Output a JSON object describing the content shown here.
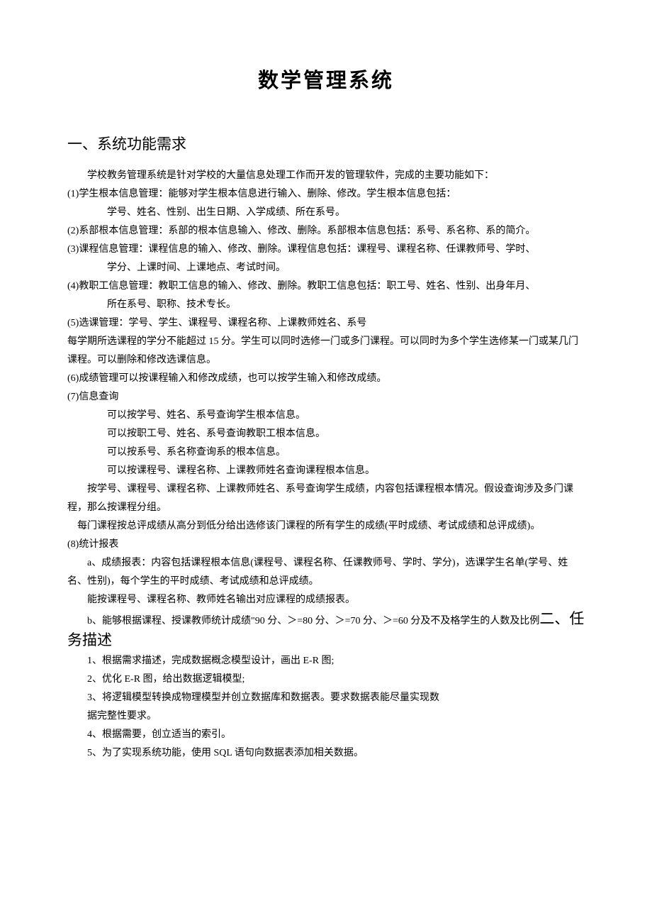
{
  "title": "数学管理系统",
  "section1": {
    "heading": "一、系统功能需求",
    "intro": "学校教务管理系统是针对学校的大量信息处理工作而开发的管理软件，完成的主要功能如下：",
    "items": [
      {
        "line1": "(1)学生根本信息管理：能够对学生根本信息进行输入、删除、修改。学生根本信息包括：",
        "line2": "学号、姓名、性别、出生日期、入学成绩、所在系号。"
      },
      {
        "line1": "(2)系部根本信息管理：系部的根本信息输入、修改、删除。系部根本信息包括：系号、系名称、系的简介。"
      },
      {
        "line1": "(3)课程信息管理：课程信息的输入、修改、删除。课程信息包括：课程号、课程名称、任课教师号、学时、",
        "line2": "学分、上课时间、上课地点、考试时间。"
      },
      {
        "line1": "(4)教职工信息管理：教职工信息的输入、修改、删除。教职工信息包括：职工号、姓名、性别、出身年月、",
        "line2": "所在系号、职称、技术专长。"
      },
      {
        "line1": "(5)选课管理：学号、学生、课程号、课程名称、上课教师姓名、系号",
        "extra1": "每学期所选课程的学分不能超过 15 分。学生可以同时选修一门或多门课程。可以同时为多个学生选修某一门或某几门课程。可以删除和修改选课信息。"
      },
      {
        "line1": "(6)成绩管理可以按课程输入和修改成绩，也可以按学生输入和修改成绩。"
      },
      {
        "line1": "(7)信息查询",
        "sub": [
          "可以按学号、姓名、系号查询学生根本信息。",
          "可以按职工号、姓名、系号查询教职工根本信息。",
          "可以按系号、系名称查询系的根本信息。",
          "可以按课程号、课程名称、上课教师姓名查询课程根本信息。"
        ],
        "extra1": "按学号、课程号、课程名称、上课教师姓名、系号查询学生成绩，内容包括课程根本情况。假设查询涉及多门课程，那么按课程分组。",
        "extra2": "每门课程按总评成绩从高分到低分给出选修该门课程的所有学生的成绩(平时成绩、考试成绩和总评成绩)。"
      },
      {
        "line1": "(8)统计报表",
        "suba": "a、成绩报表：内容包括课程根本信息(课程号、课程名称、任课教师号、学时、学分)，选课学生名单(学号、姓名、性别)，每个学生的平时成绩、考试成绩和总评成绩。",
        "suba2": "能按课程号、课程名称、教师姓名输出对应课程的成绩报表。",
        "subb_prefix": "b、能够根据课程、授课教师统计成绩\"90 分、＞=80 分、＞=70 分、＞=60 分及不及格学生的人数及比例"
      }
    ]
  },
  "section2": {
    "heading": "二、任务描述",
    "items": [
      "1、根据需求描述，完成数据概念模型设计，画出 E-R 图;",
      "2、优化 E-R 图，给出数据逻辑模型;",
      "3、将逻辑模型转换成物理模型并创立数据库和数据表。要求数据表能尽量实现数",
      "据完整性要求。",
      "4、根据需要，创立适当的索引。",
      "5、为了实现系统功能，使用 SQL 语句向数据表添加相关数据。"
    ]
  }
}
